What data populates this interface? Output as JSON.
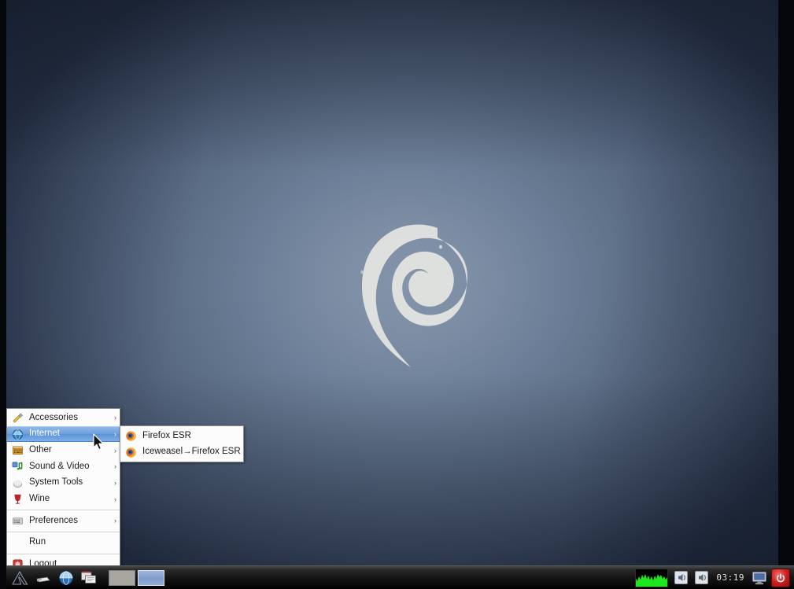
{
  "desktop": {
    "wallpaper_logo": "debian-swirl",
    "bg_center_color": "#7385a0",
    "bg_edge_color": "#2b374d"
  },
  "menu": {
    "items": [
      {
        "label": "Accessories",
        "icon": "accessories-icon",
        "has_submenu": true,
        "selected": false
      },
      {
        "label": "Internet",
        "icon": "globe-icon",
        "has_submenu": true,
        "selected": true
      },
      {
        "label": "Other",
        "icon": "other-icon",
        "has_submenu": true,
        "selected": false
      },
      {
        "label": "Sound & Video",
        "icon": "music-note-icon",
        "has_submenu": true,
        "selected": false
      },
      {
        "label": "System Tools",
        "icon": "system-tools-icon",
        "has_submenu": true,
        "selected": false
      },
      {
        "label": "Wine",
        "icon": "wine-glass-icon",
        "has_submenu": true,
        "selected": false
      }
    ],
    "footer_items": [
      {
        "label": "Preferences",
        "icon": "preferences-icon",
        "has_submenu": true,
        "selected": false
      },
      {
        "label": "Run",
        "icon": "none",
        "has_submenu": false,
        "selected": false
      },
      {
        "label": "Logout",
        "icon": "logout-icon",
        "has_submenu": false,
        "selected": false
      }
    ],
    "submenu_arrow": "›",
    "highlight_color": "#5b92d6"
  },
  "submenu": {
    "parent": "Internet",
    "items": [
      {
        "label": "Firefox ESR",
        "icon": "firefox-icon"
      },
      {
        "label": "Iceweasel→Firefox ESR",
        "icon": "firefox-icon"
      }
    ]
  },
  "panel": {
    "launchers": [
      {
        "name": "main-menu-button",
        "icon": "mountain-logo-icon"
      },
      {
        "name": "terminal-launcher",
        "icon": "terminal-icon"
      },
      {
        "name": "browser-launcher",
        "icon": "globe-icon"
      },
      {
        "name": "file-manager-launcher",
        "icon": "file-manager-icon"
      }
    ],
    "pager": [
      {
        "name": "workspace-1",
        "active": false
      },
      {
        "name": "workspace-2",
        "active": true
      }
    ],
    "tray": [
      {
        "name": "cpu-monitor",
        "icon": "cpu-graph-icon",
        "color": "#22ee22"
      },
      {
        "name": "volume-icon-1",
        "icon": "speaker-icon"
      },
      {
        "name": "volume-icon-2",
        "icon": "speaker-icon"
      }
    ],
    "clock": "03:19",
    "display_icon": "monitor-icon",
    "power_icon": "power-icon"
  }
}
